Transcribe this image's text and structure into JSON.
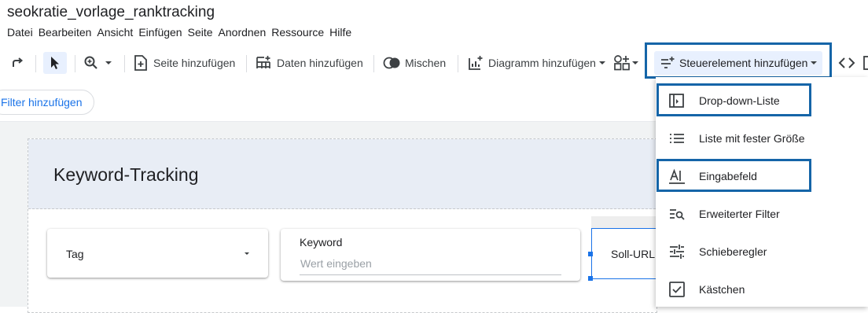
{
  "app": {
    "doc_title": "seokratie_vorlage_ranktracking"
  },
  "menubar": {
    "items": [
      "Datei",
      "Bearbeiten",
      "Ansicht",
      "Einfügen",
      "Seite",
      "Anordnen",
      "Ressource",
      "Hilfe"
    ]
  },
  "toolbar": {
    "add_page": "Seite hinzufügen",
    "add_data": "Daten hinzufügen",
    "blend": "Mischen",
    "add_chart": "Diagramm hinzufügen",
    "add_control": "Steuerelement hinzufügen"
  },
  "filterbar": {
    "add_filter": "Filter hinzufügen"
  },
  "report": {
    "title": "Keyword-Tracking",
    "controls": {
      "tag_label": "Tag",
      "keyword_label": "Keyword",
      "keyword_placeholder": "Wert eingeben",
      "soll_url_label": "Soll-URL"
    }
  },
  "control_menu": {
    "items": [
      {
        "label": "Drop-down-Liste",
        "icon": "dropdown-list-icon"
      },
      {
        "label": "Liste mit fester Größe",
        "icon": "fixed-size-list-icon"
      },
      {
        "label": "Eingabefeld",
        "icon": "input-field-icon"
      },
      {
        "label": "Erweiterter Filter",
        "icon": "advanced-filter-icon"
      },
      {
        "label": "Schieberegler",
        "icon": "slider-icon"
      },
      {
        "label": "Kästchen",
        "icon": "checkbox-icon"
      }
    ]
  },
  "colors": {
    "highlight": "#1565a8",
    "accent": "#1a73e8",
    "header_band": "#e8edf5"
  }
}
